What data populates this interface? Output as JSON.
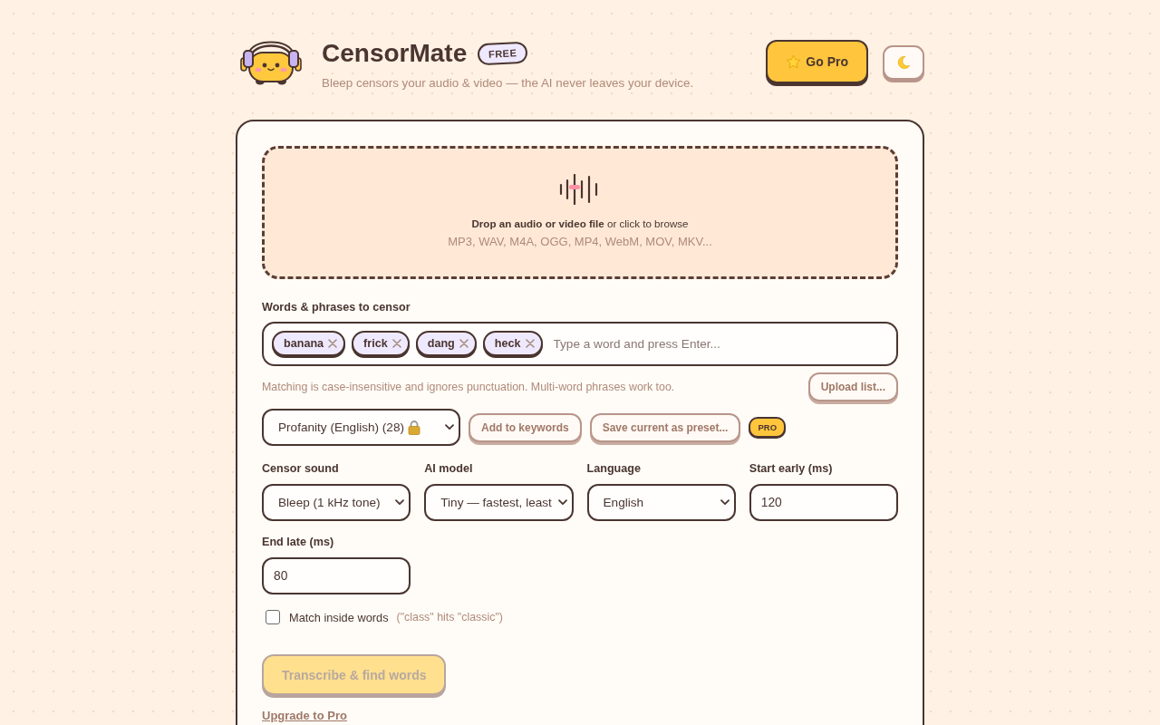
{
  "header": {
    "title": "CensorMate",
    "plan_badge": "FREE",
    "subtitle": "Bleep censors your audio & video — the AI never leaves your device.",
    "pro_button": "Go Pro"
  },
  "dropzone": {
    "prompt": "**Drop an audio or video file** or click to browse",
    "formats": "MP3, WAV, M4A, OGG, MP4, WebM, MOV, MKV..."
  },
  "keywords": {
    "label": "Words & phrases to censor",
    "tags": [
      "banana",
      "frick",
      "dang",
      "heck"
    ],
    "placeholder": "Type a word and press Enter...",
    "hint": "Matching is case-insensitive and ignores punctuation. Multi-word phrases work too.",
    "upload_button": "Upload list..."
  },
  "presets": {
    "select": {
      "value": "Profanity (English) (28)",
      "locked": true
    },
    "add_button": "Add to keywords",
    "save_button": "Save current as preset...",
    "pro_badge": "PRO"
  },
  "settings": [
    {
      "kind": "select",
      "label": "Censor sound",
      "value": "Bleep (1 kHz tone)"
    },
    {
      "kind": "select",
      "label": "AI model",
      "value": "Tiny — fastest, least"
    },
    {
      "kind": "select",
      "label": "Language",
      "value": "English"
    },
    {
      "kind": "number",
      "label": "Start early (ms)",
      "value": "120"
    },
    {
      "kind": "number",
      "label": "End late (ms)",
      "value": "80"
    }
  ],
  "match_inside_words": {
    "label": "Match inside words",
    "hint": "(\"class\" hits \"classic\")",
    "checked": false
  },
  "transcribe_button": {
    "label": "Transcribe & find words",
    "disabled": true
  },
  "upgrade_link": "Upgrade to Pro"
}
